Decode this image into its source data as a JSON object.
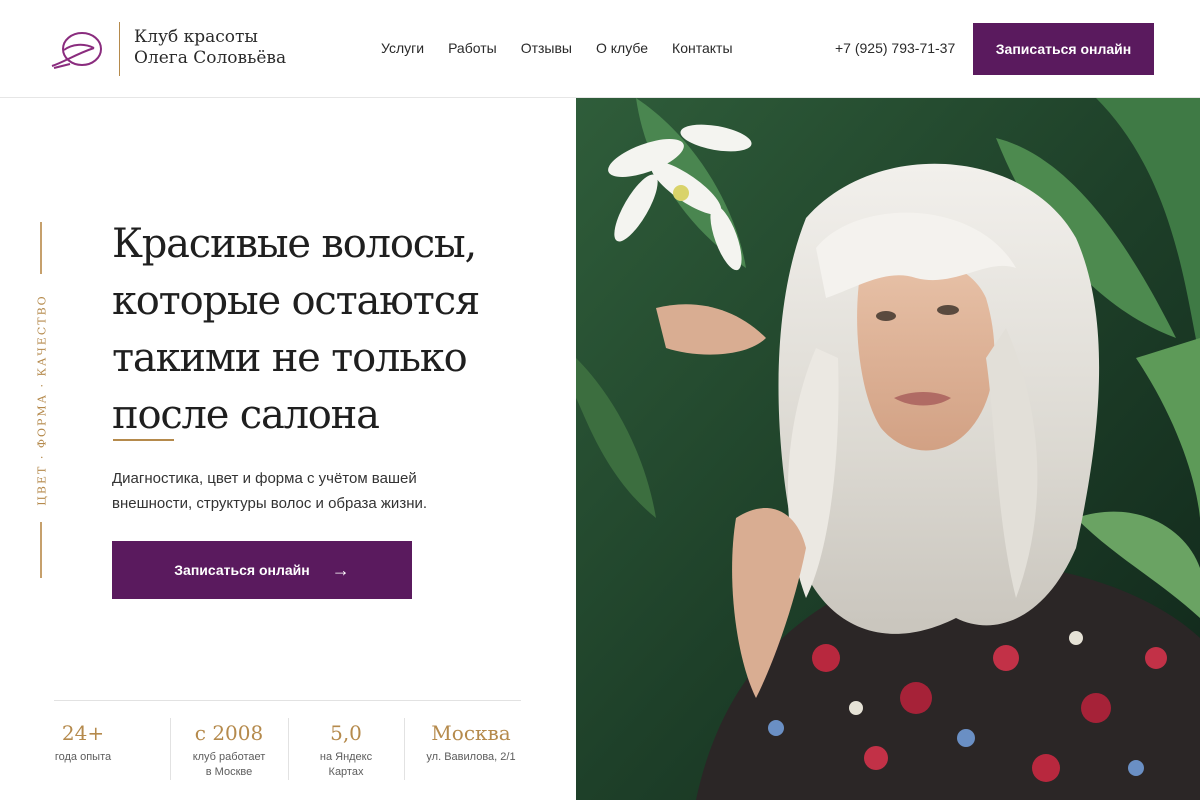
{
  "header": {
    "logo_line1": "Клуб красоты",
    "logo_line2": "Олега Соловьёва",
    "nav": [
      "Услуги",
      "Работы",
      "Отзывы",
      "О клубе",
      "Контакты"
    ],
    "phone": "+7 (925) 793-71-37",
    "cta_label": "Записаться онлайн"
  },
  "hero": {
    "side_text": "ЦВЕТ · ФОРМА · КАЧЕСТВО",
    "headline": [
      "Красивые волосы,",
      "которые остаются",
      "такими не только",
      "после салона"
    ],
    "lead": "Диагностика, цвет и форма с учётом вашей внешности, структуры волос и образа жизни.",
    "cta_label": "Записаться онлайн",
    "cta_icon": "arrow-right-icon"
  },
  "stats": [
    {
      "value": "24+",
      "caption": [
        "года опыта"
      ]
    },
    {
      "value": "с 2008",
      "caption": [
        "клуб работает",
        "в Москве"
      ]
    },
    {
      "value": "5,0",
      "caption": [
        "на Яндекс",
        "Картах"
      ]
    },
    {
      "value": "Москва",
      "caption": [
        "ул. Вавилова, 2/1"
      ]
    }
  ],
  "colors": {
    "brand_purple": "#5a1a5e",
    "accent_gold": "#b58a4c",
    "text_dark": "#1f1f1f"
  },
  "photo": {
    "icon": "hero-photo"
  }
}
